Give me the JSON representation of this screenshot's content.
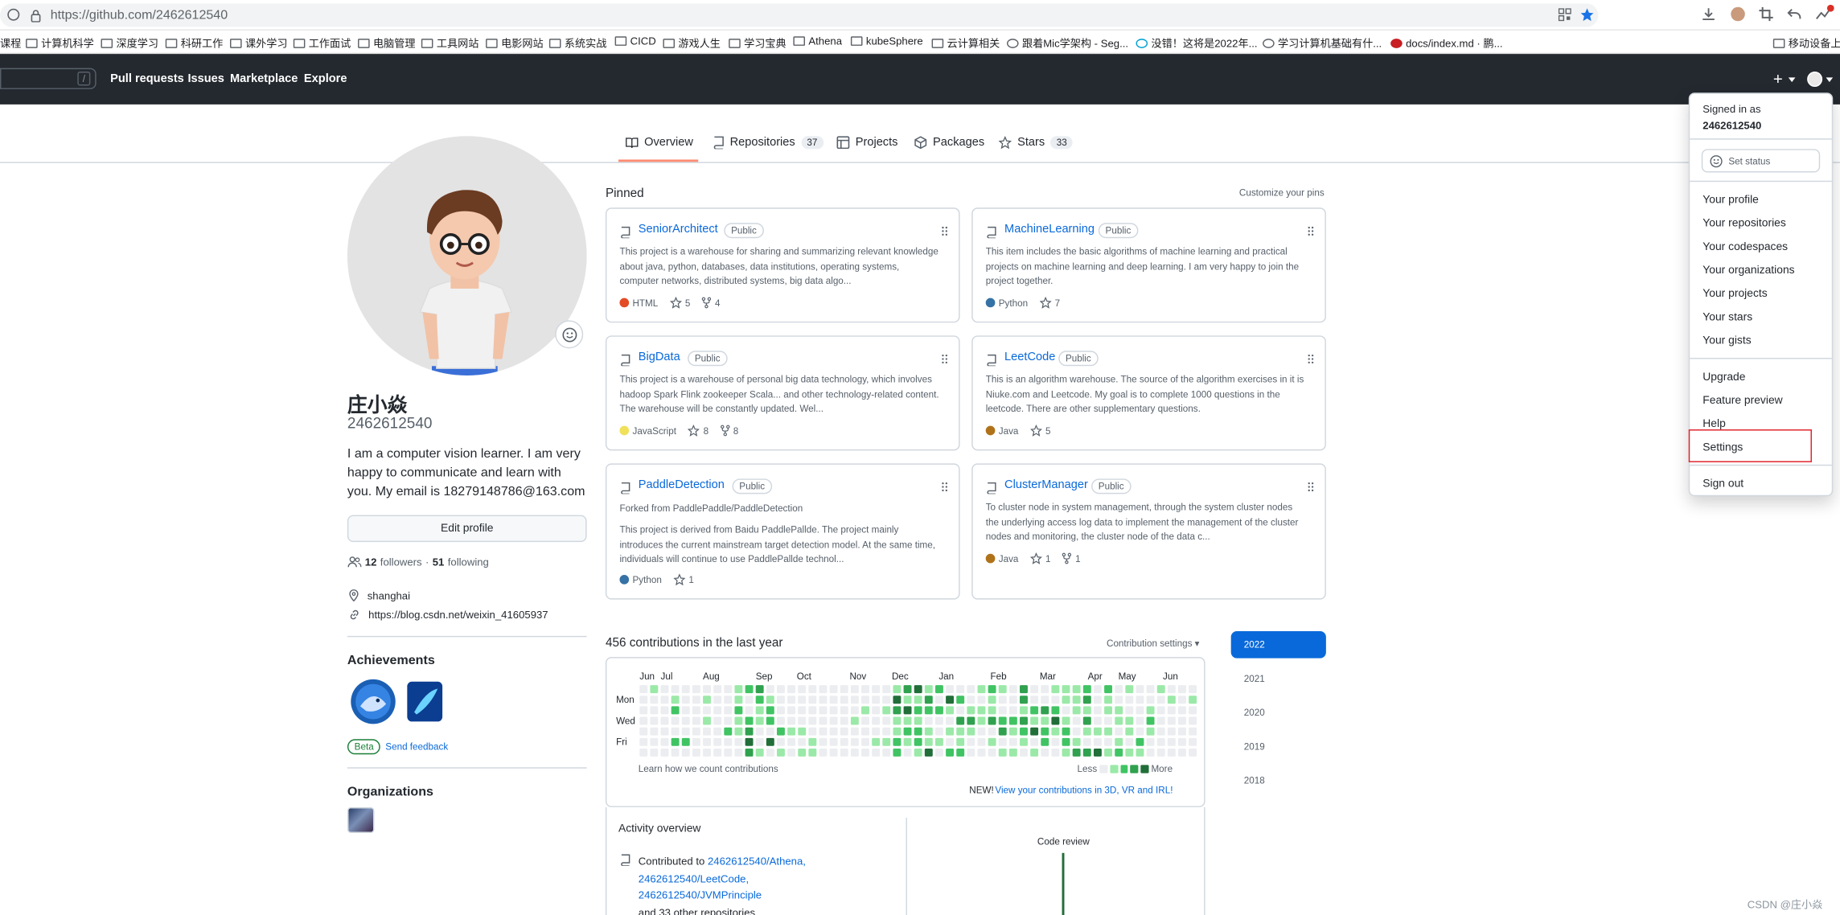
{
  "browser": {
    "url": "https://github.com/2462612540",
    "bookmarks": [
      "课程",
      "计算机科学",
      "深度学习",
      "科研工作",
      "课外学习",
      "工作面试",
      "电脑管理",
      "工具网站",
      "电影网站",
      "系统实战",
      "CICD",
      "游戏人生",
      "学习宝典",
      "Athena",
      "kubeSphere",
      "云计算相关",
      "跟着Mic学架构 - Seg...",
      "没错！这将是2022年...",
      "学习计算机基础有什...",
      "docs/index.md · 鹏...",
      "移动设备上的"
    ]
  },
  "header": {
    "search_key": "/",
    "nav": [
      "Pull requests",
      "Issues",
      "Marketplace",
      "Explore"
    ],
    "plus": "+"
  },
  "tabs": [
    {
      "label": "Overview",
      "count": ""
    },
    {
      "label": "Repositories",
      "count": "37"
    },
    {
      "label": "Projects",
      "count": ""
    },
    {
      "label": "Packages",
      "count": ""
    },
    {
      "label": "Stars",
      "count": "33"
    }
  ],
  "profile": {
    "name": "庄小焱",
    "login": "2462612540",
    "bio_lines": [
      "I am a computer vision learner. I am very",
      "happy to communicate and learn with",
      "you. My email is 18279148786@163.com"
    ],
    "edit_label": "Edit profile",
    "followers": "12",
    "followers_label": "followers",
    "sep": "·",
    "following": "51",
    "following_label": "following",
    "location": "shanghai",
    "website": "https://blog.csdn.net/weixin_41605937",
    "achievements_title": "Achievements",
    "beta": "Beta",
    "feedback": "Send feedback",
    "organizations_title": "Organizations"
  },
  "pinned": {
    "title": "Pinned",
    "customize": "Customize your pins",
    "repos": [
      {
        "name": "SeniorArchitect",
        "badge": "Public",
        "desc": [
          "This project is a warehouse for sharing and summarizing relevant knowledge",
          "about java, python, databases, data institutions, operating systems,",
          "computer networks, distributed systems, big data algo..."
        ],
        "lang": "HTML",
        "lang_color": "#e34c26",
        "stars": "5",
        "forks": "4"
      },
      {
        "name": "MachineLearning",
        "badge": "Public",
        "desc": [
          "This item includes the basic algorithms of machine learning and practical",
          "projects on machine learning and deep learning. I am very happy to join the",
          "project together."
        ],
        "lang": "Python",
        "lang_color": "#3572a5",
        "stars": "7",
        "forks": ""
      },
      {
        "name": "BigData",
        "badge": "Public",
        "desc": [
          "This project is a warehouse of personal big data technology, which involves",
          "hadoop Spark Flink zookeeper Scala... and other technology-related content.",
          "The warehouse will be constantly updated. Wel..."
        ],
        "lang": "JavaScript",
        "lang_color": "#f1e05a",
        "stars": "8",
        "forks": "8"
      },
      {
        "name": "LeetCode",
        "badge": "Public",
        "desc": [
          "This is an algorithm warehouse. The source of the algorithm exercises in it is",
          "Niuke.com and Leetcode. My goal is to complete 1000 questions in the",
          "leetcode. There are other supplementary questions."
        ],
        "lang": "Java",
        "lang_color": "#b07219",
        "stars": "5",
        "forks": ""
      },
      {
        "name": "PaddleDetection",
        "badge": "Public",
        "fork": "Forked from PaddlePaddle/PaddleDetection",
        "desc": [
          "This project is derived from Baidu PaddlePallde. The project mainly",
          "introduces the current mainstream target detection model. At the same time,",
          "individuals will continue to use PaddlePallde technol..."
        ],
        "lang": "Python",
        "lang_color": "#3572a5",
        "stars": "1",
        "forks": ""
      },
      {
        "name": "ClusterManager",
        "badge": "Public",
        "desc": [
          "To cluster node in system management, through the system cluster nodes",
          "the underlying access log data to implement the management of the cluster",
          "nodes and monitoring, the cluster node of the data c..."
        ],
        "lang": "Java",
        "lang_color": "#b07219",
        "stars": "1",
        "forks": "1"
      }
    ]
  },
  "contributions": {
    "title": "456 contributions in the last year",
    "settings": "Contribution settings",
    "months": [
      "Jun",
      "Jul",
      "Aug",
      "Sep",
      "Oct",
      "Nov",
      "Dec",
      "Jan",
      "Feb",
      "Mar",
      "Apr",
      "May",
      "Jun"
    ],
    "days": [
      "Mon",
      "Wed",
      "Fri"
    ],
    "learn": "Learn how we count contributions",
    "less": "Less",
    "more": "More",
    "new_label": "NEW!",
    "new_link": "View your contributions in 3D, VR and IRL!",
    "colors": [
      "#ebedf0",
      "#9be9a8",
      "#40c463",
      "#30a14e",
      "#216e39"
    ],
    "years": [
      "2022",
      "2021",
      "2020",
      "2019",
      "2018"
    ]
  },
  "activity": {
    "title": "Activity overview",
    "contributed": "Contributed to",
    "repos": [
      "2462612540/Athena,",
      "2462612540/LeetCode,",
      "2462612540/JVMPrinciple"
    ],
    "more": "and 33 other repositories",
    "code_review": "Code review"
  },
  "menu": {
    "signed_in": "Signed in as",
    "user": "2462612540",
    "set_status": "Set status",
    "group1": [
      "Your profile",
      "Your repositories",
      "Your codespaces",
      "Your organizations",
      "Your projects",
      "Your stars",
      "Your gists"
    ],
    "group2": [
      "Upgrade",
      "Feature preview",
      "Help",
      "Settings"
    ],
    "signout": "Sign out"
  },
  "watermark": "CSDN @庄小焱"
}
